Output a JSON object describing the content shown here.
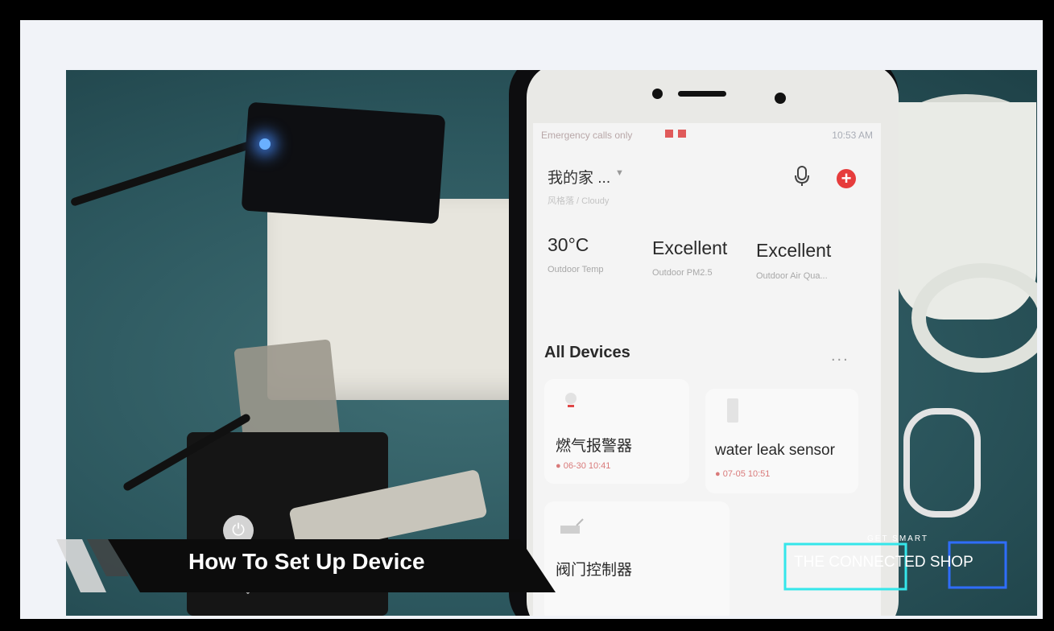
{
  "video": {
    "title": "How To Set Up Device",
    "brand": {
      "tagline": "GET SMART",
      "name": "THE CONNECTED SHOP"
    }
  },
  "phone": {
    "status_bar": {
      "left": "Emergency calls only",
      "time": "10:53 AM"
    },
    "home": {
      "name": "我的家 ...",
      "caret": "▼",
      "weather": "风格落 / Cloudy"
    },
    "metrics": [
      {
        "value": "30°C",
        "label": "Outdoor Temp"
      },
      {
        "value": "Excellent",
        "label": "Outdoor PM2.5"
      },
      {
        "value": "Excellent",
        "label": "Outdoor Air Qua..."
      }
    ],
    "section_title": "All Devices",
    "more": "...",
    "devices": [
      {
        "name": "燃气报警器",
        "time": "● 06-30 10:41"
      },
      {
        "name": "water leak sensor",
        "time": "● 07-05 10:51"
      },
      {
        "name": "阀门控制器"
      }
    ],
    "add_symbol": "+"
  },
  "colors": {
    "accent_red": "#e63c3c",
    "brand_cyan": "#35e6ea",
    "brand_blue": "#2f6dff"
  }
}
